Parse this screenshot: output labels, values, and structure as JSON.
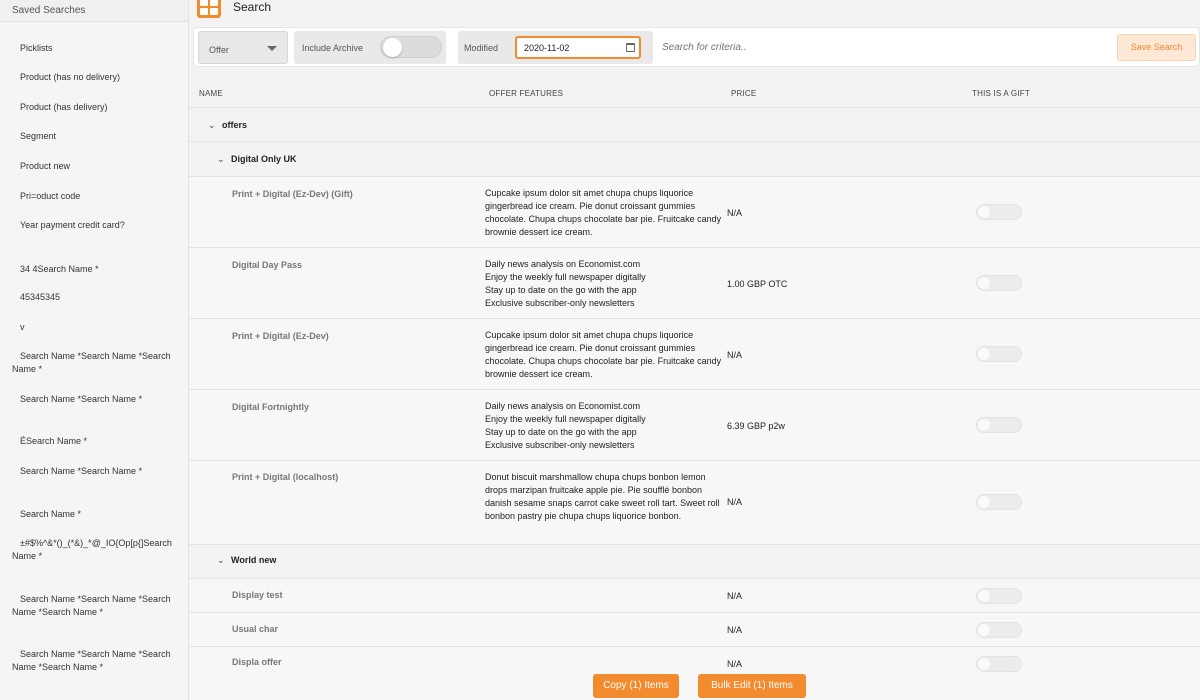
{
  "sidebar": {
    "header": "Saved Searches",
    "items": [
      "Picklists",
      "Product (has no delivery)",
      "Product (has delivery)",
      "Segment",
      "Product new",
      "Pri=oduct code",
      "Year payment credit card?",
      "34 4Search Name *",
      "45345345",
      "v",
      "Search Name *Search Name *Search Name *",
      "Search Name *Search Name *",
      "ÉSearch Name *",
      "Search Name *Search Name *",
      "Search Name *",
      "±#$%^&*()_(*&)_*@_IO{Op[p{]Search Name *",
      "Search Name *Search Name *Search Name *Search Name *",
      "Search Name *Search Name *Search Name *Search Name *"
    ]
  },
  "header": {
    "title": "Search"
  },
  "filters": {
    "type_select": "Offer",
    "include_archive_label": "Include Archive",
    "modified_label": "Modified",
    "modified_value": "2020-11-02",
    "search_placeholder": "Search for criteria..",
    "save_label": "Save Search"
  },
  "table": {
    "columns": [
      "NAME",
      "OFFER FEATURES",
      "PRICE",
      "THIS IS A GIFT"
    ],
    "root_group": "offers",
    "group1": "Digital Only UK",
    "group2": "World new",
    "rows": [
      {
        "name": "Print + Digital (Ez-Dev) (Gift)",
        "features": "Cupcake ipsum dolor sit amet chupa chups liquorice gingerbread ice cream. Pie donut croissant gummies chocolate. Chupa chups chocolate bar pie. Fruitcake candy brownie dessert ice cream.",
        "price": "N/A"
      },
      {
        "name": "Digital Day Pass",
        "features": "Daily news analysis on Economist.com\nEnjoy the weekly full newspaper digitally\nStay up to date on the go with the app\nExclusive subscriber-only newsletters",
        "price": "1.00 GBP OTC"
      },
      {
        "name": "Print + Digital (Ez-Dev)",
        "features": "Cupcake ipsum dolor sit amet chupa chups liquorice gingerbread ice cream. Pie donut croissant gummies chocolate. Chupa chups chocolate bar pie. Fruitcake candy brownie dessert ice cream.",
        "price": "N/A"
      },
      {
        "name": "Digital Fortnightly",
        "features": "Daily news analysis on Economist.com\nEnjoy the weekly full newspaper digitally\nStay up to date on the go with the app\nExclusive subscriber-only newsletters",
        "price": "6.39 GBP p2w"
      },
      {
        "name": "Print + Digital (localhost)",
        "features": "Donut biscuit marshmallow chupa chups bonbon lemon drops marzipan fruitcake apple pie. Pie soufflé bonbon danish sesame snaps carrot cake sweet roll tart. Sweet roll bonbon pastry pie chupa chups liquorice bonbon.",
        "price": "N/A"
      },
      {
        "name": "Display test",
        "features": "",
        "price": "N/A"
      },
      {
        "name": "Usual char",
        "features": "",
        "price": "N/A"
      },
      {
        "name": "Displa offer",
        "features": "",
        "price": "N/A"
      }
    ]
  },
  "actions": {
    "copy_label": "Copy (1) Items",
    "bulk_edit_label": "Bulk Edit (1) Items"
  },
  "colors": {
    "accent": "#f28a2e"
  }
}
